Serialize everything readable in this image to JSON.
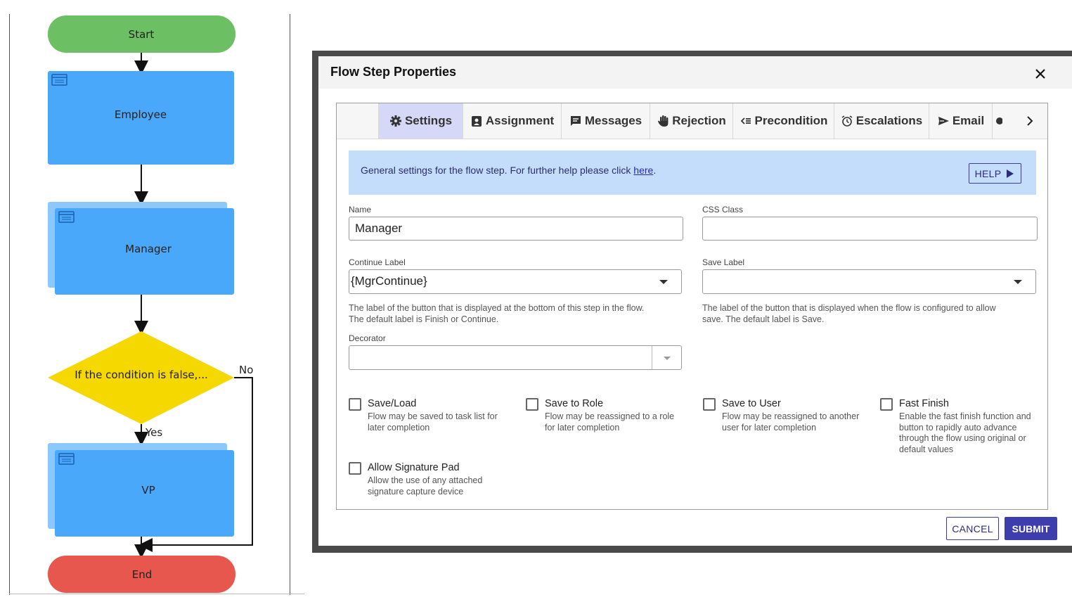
{
  "flowchart": {
    "start_label": "Start",
    "employee_label": "Employee",
    "manager_label": "Manager",
    "condition_label": "If the condition is false,...",
    "no_label": "No",
    "yes_label": "Yes",
    "vp_label": "VP",
    "end_label": "End",
    "colors": {
      "start": "#6cc063",
      "task": "#4aa8fa",
      "decision": "#f5d800",
      "end": "#e8574e"
    }
  },
  "dialog": {
    "title": "Flow Step Properties",
    "close_icon": "close-icon",
    "tabs": [
      {
        "label": "Settings",
        "icon": "gear-icon",
        "active": true
      },
      {
        "label": "Assignment",
        "icon": "badge-icon"
      },
      {
        "label": "Messages",
        "icon": "message-icon"
      },
      {
        "label": "Rejection",
        "icon": "hand-icon"
      },
      {
        "label": "Precondition",
        "icon": "precondition-icon"
      },
      {
        "label": "Escalations",
        "icon": "alarm-clock-icon"
      },
      {
        "label": "Email",
        "icon": "send-icon"
      }
    ],
    "banner": {
      "text": "General settings for the flow step. For further help please click ",
      "link": "here",
      "suffix": ".",
      "help_button": "HELP"
    },
    "fields": {
      "name_label": "Name",
      "name_value": "Manager",
      "css_label": "CSS Class",
      "css_value": "",
      "continue_label": "Continue Label",
      "continue_value": "{MgrContinue}",
      "continue_help": "The label of the button that is displayed at the bottom of this step in the flow. The default label is Finish or Continue.",
      "save_label": "Save Label",
      "save_value": "",
      "save_help": "The label of the button that is displayed when the flow is configured to allow save. The default label is Save.",
      "decorator_label": "Decorator",
      "decorator_value": ""
    },
    "checkboxes": [
      {
        "title": "Save/Load",
        "desc": "Flow may be saved to task list for later completion",
        "checked": false
      },
      {
        "title": "Save to Role",
        "desc": "Flow may be reassigned to a role for later completion",
        "checked": false
      },
      {
        "title": "Save to User",
        "desc": "Flow may be reassigned to another user for later completion",
        "checked": false
      },
      {
        "title": "Fast Finish",
        "desc": "Enable the fast finish function and button to rapidly auto advance through the flow using original or default values",
        "checked": false
      },
      {
        "title": "Allow Signature Pad",
        "desc": "Allow the use of any attached signature capture device",
        "checked": false
      }
    ],
    "cancel_button": "CANCEL",
    "submit_button": "SUBMIT",
    "accent_color": "#3d3dad",
    "banner_color": "#c4ddfa"
  }
}
